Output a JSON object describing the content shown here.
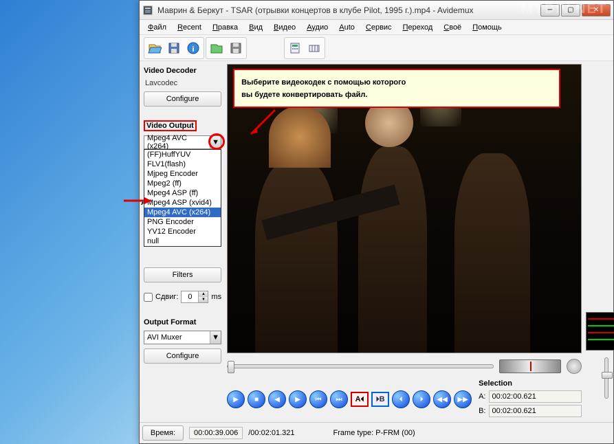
{
  "watermark": "MYDIV.NET",
  "window": {
    "title": "Маврин & Беркут - TSAR (отрывки концертов в клубе Pilot, 1995 г.).mp4 - Avidemux"
  },
  "menus": [
    "Файл",
    "Recent",
    "Правка",
    "Вид",
    "Видео",
    "Аудио",
    "Auto",
    "Сервис",
    "Переход",
    "Своё",
    "Помощь"
  ],
  "tooltip": [
    "Выберите видеокодек с помощью которого",
    "вы будете конвертировать файл."
  ],
  "decoder": {
    "label": "Video Decoder",
    "value": "Lavcodec",
    "configure": "Configure"
  },
  "video_output": {
    "label": "Video Output",
    "selected": "Mpeg4 AVC (x264)",
    "options": [
      "(FF)HuffYUV",
      "FLV1(flash)",
      "Mjpeg Encoder",
      "Mpeg2 (ff)",
      "Mpeg4 ASP (ff)",
      "Mpeg4 ASP (xvid4)",
      "Mpeg4 AVC (x264)",
      "PNG Encoder",
      "YV12 Encoder",
      "null"
    ],
    "highlighted": "Mpeg4 AVC (x264)",
    "filters": "Filters"
  },
  "shift": {
    "label": "Сдвиг:",
    "value": "0",
    "unit": "ms"
  },
  "output_format": {
    "label": "Output Format",
    "selected": "AVI Muxer",
    "configure": "Configure"
  },
  "selection": {
    "label": "Selection",
    "a_label": "A:",
    "a_value": "00:02:00.621",
    "b_label": "B:",
    "b_value": "00:02:00.621"
  },
  "status": {
    "time_label": "Время:",
    "time_value": "00:00:39.006",
    "duration": "/00:02:01.321",
    "frame_type": "Frame type: P-FRM (00)"
  },
  "markers": {
    "a": "A",
    "b": "B"
  },
  "hidden_label": "Au"
}
